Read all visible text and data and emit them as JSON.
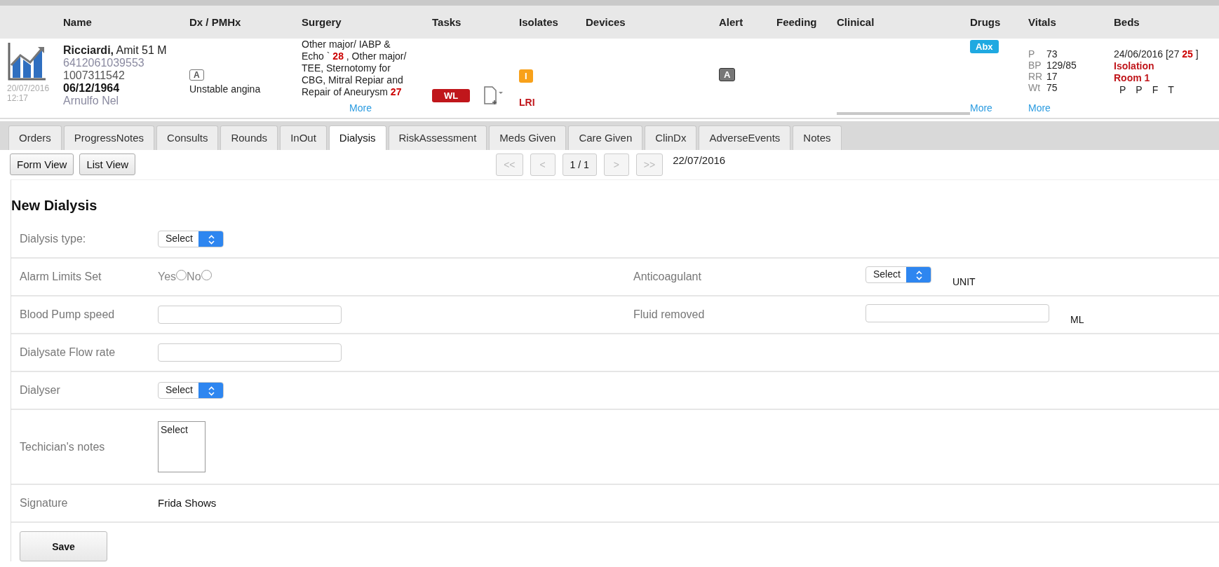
{
  "header": {
    "columns": [
      "Name",
      "Dx / PMHx",
      "Surgery",
      "Tasks",
      "Isolates",
      "Devices",
      "Alert",
      "Feeding",
      "Clinical",
      "Drugs",
      "Vitals",
      "Beds"
    ]
  },
  "patient": {
    "date": "20/07/2016",
    "time": "12:17",
    "name": "**Ricciardi,** Amit 51 M",
    "mrn": "6412061039553",
    "id": "1007311542",
    "dob": "06/12/1964",
    "doctor": "Arnulfo Nel",
    "dx": {
      "badge": "A",
      "text": "Unstable angina"
    },
    "surgery": {
      "text": "Other major/ IABP & Echo ` **28** , Other major/ TEE, Sternotomy for CBG, Mitral Repiar and Repair of Aneurysm **27**",
      "more": "More"
    },
    "tasks": {
      "badge": "WL"
    },
    "isolates": {
      "badge": "I",
      "code": "LRI"
    },
    "alert": {
      "badge": "A"
    },
    "drugs": {
      "badge": "Abx",
      "more": "More"
    },
    "vitals": {
      "items": [
        {
          "label": "P",
          "value": "73"
        },
        {
          "label": "BP",
          "value": "129/85"
        },
        {
          "label": "RR",
          "value": "17"
        },
        {
          "label": "Wt",
          "value": "75"
        }
      ],
      "more": "More"
    },
    "beds": {
      "line": "24/06/2016 [27 **25** ]",
      "status": "Isolation",
      "room": "Room 1",
      "flags": [
        "P",
        "P",
        "F",
        "T"
      ]
    }
  },
  "tabs": [
    {
      "label": "Orders",
      "selected": false
    },
    {
      "label": "ProgressNotes",
      "selected": false
    },
    {
      "label": "Consults",
      "selected": false
    },
    {
      "label": "Rounds",
      "selected": false
    },
    {
      "label": "InOut",
      "selected": false
    },
    {
      "label": "Dialysis",
      "selected": true
    },
    {
      "label": "RiskAssessment",
      "selected": false
    },
    {
      "label": "Meds Given",
      "selected": false
    },
    {
      "label": "Care Given",
      "selected": false
    },
    {
      "label": "ClinDx",
      "selected": false
    },
    {
      "label": "AdverseEvents",
      "selected": false
    },
    {
      "label": "Notes",
      "selected": false
    }
  ],
  "toolbar": {
    "views": [
      "Form View",
      "List View"
    ],
    "pager": [
      {
        "label": "<<",
        "disabled": true
      },
      {
        "label": "<",
        "disabled": true
      },
      {
        "label": "1 / 1",
        "disabled": false
      },
      {
        "label": ">",
        "disabled": true
      },
      {
        "label": ">>",
        "disabled": true
      }
    ],
    "date": "22/07/2016"
  },
  "form": {
    "title": "New Dialysis",
    "rows": [
      {
        "label": "Dialysis type:",
        "field": {
          "kind": "select",
          "value": "Select"
        }
      },
      {
        "label": "Alarm Limits Set",
        "field": {
          "kind": "radios",
          "options": [
            {
              "label": "Yes",
              "selected": false
            },
            {
              "label": "No",
              "selected": false
            }
          ]
        },
        "right": {
          "label": "Anticoagulant",
          "field": {
            "kind": "select",
            "value": "Select"
          },
          "unit": "UNIT"
        }
      },
      {
        "label": "Blood Pump speed",
        "field": {
          "kind": "text"
        },
        "right": {
          "label": "Fluid removed",
          "field": {
            "kind": "text"
          },
          "unit": "ML"
        }
      },
      {
        "label": "Dialysate Flow rate",
        "field": {
          "kind": "text"
        }
      },
      {
        "label": "Dialyser",
        "field": {
          "kind": "select",
          "value": "Select"
        }
      },
      {
        "label": "Techician's notes",
        "field": {
          "kind": "listbox",
          "value": "Select"
        }
      },
      {
        "label": "Signature",
        "field": {
          "kind": "static",
          "value": "Frida Shows"
        }
      }
    ],
    "save": "Save"
  }
}
